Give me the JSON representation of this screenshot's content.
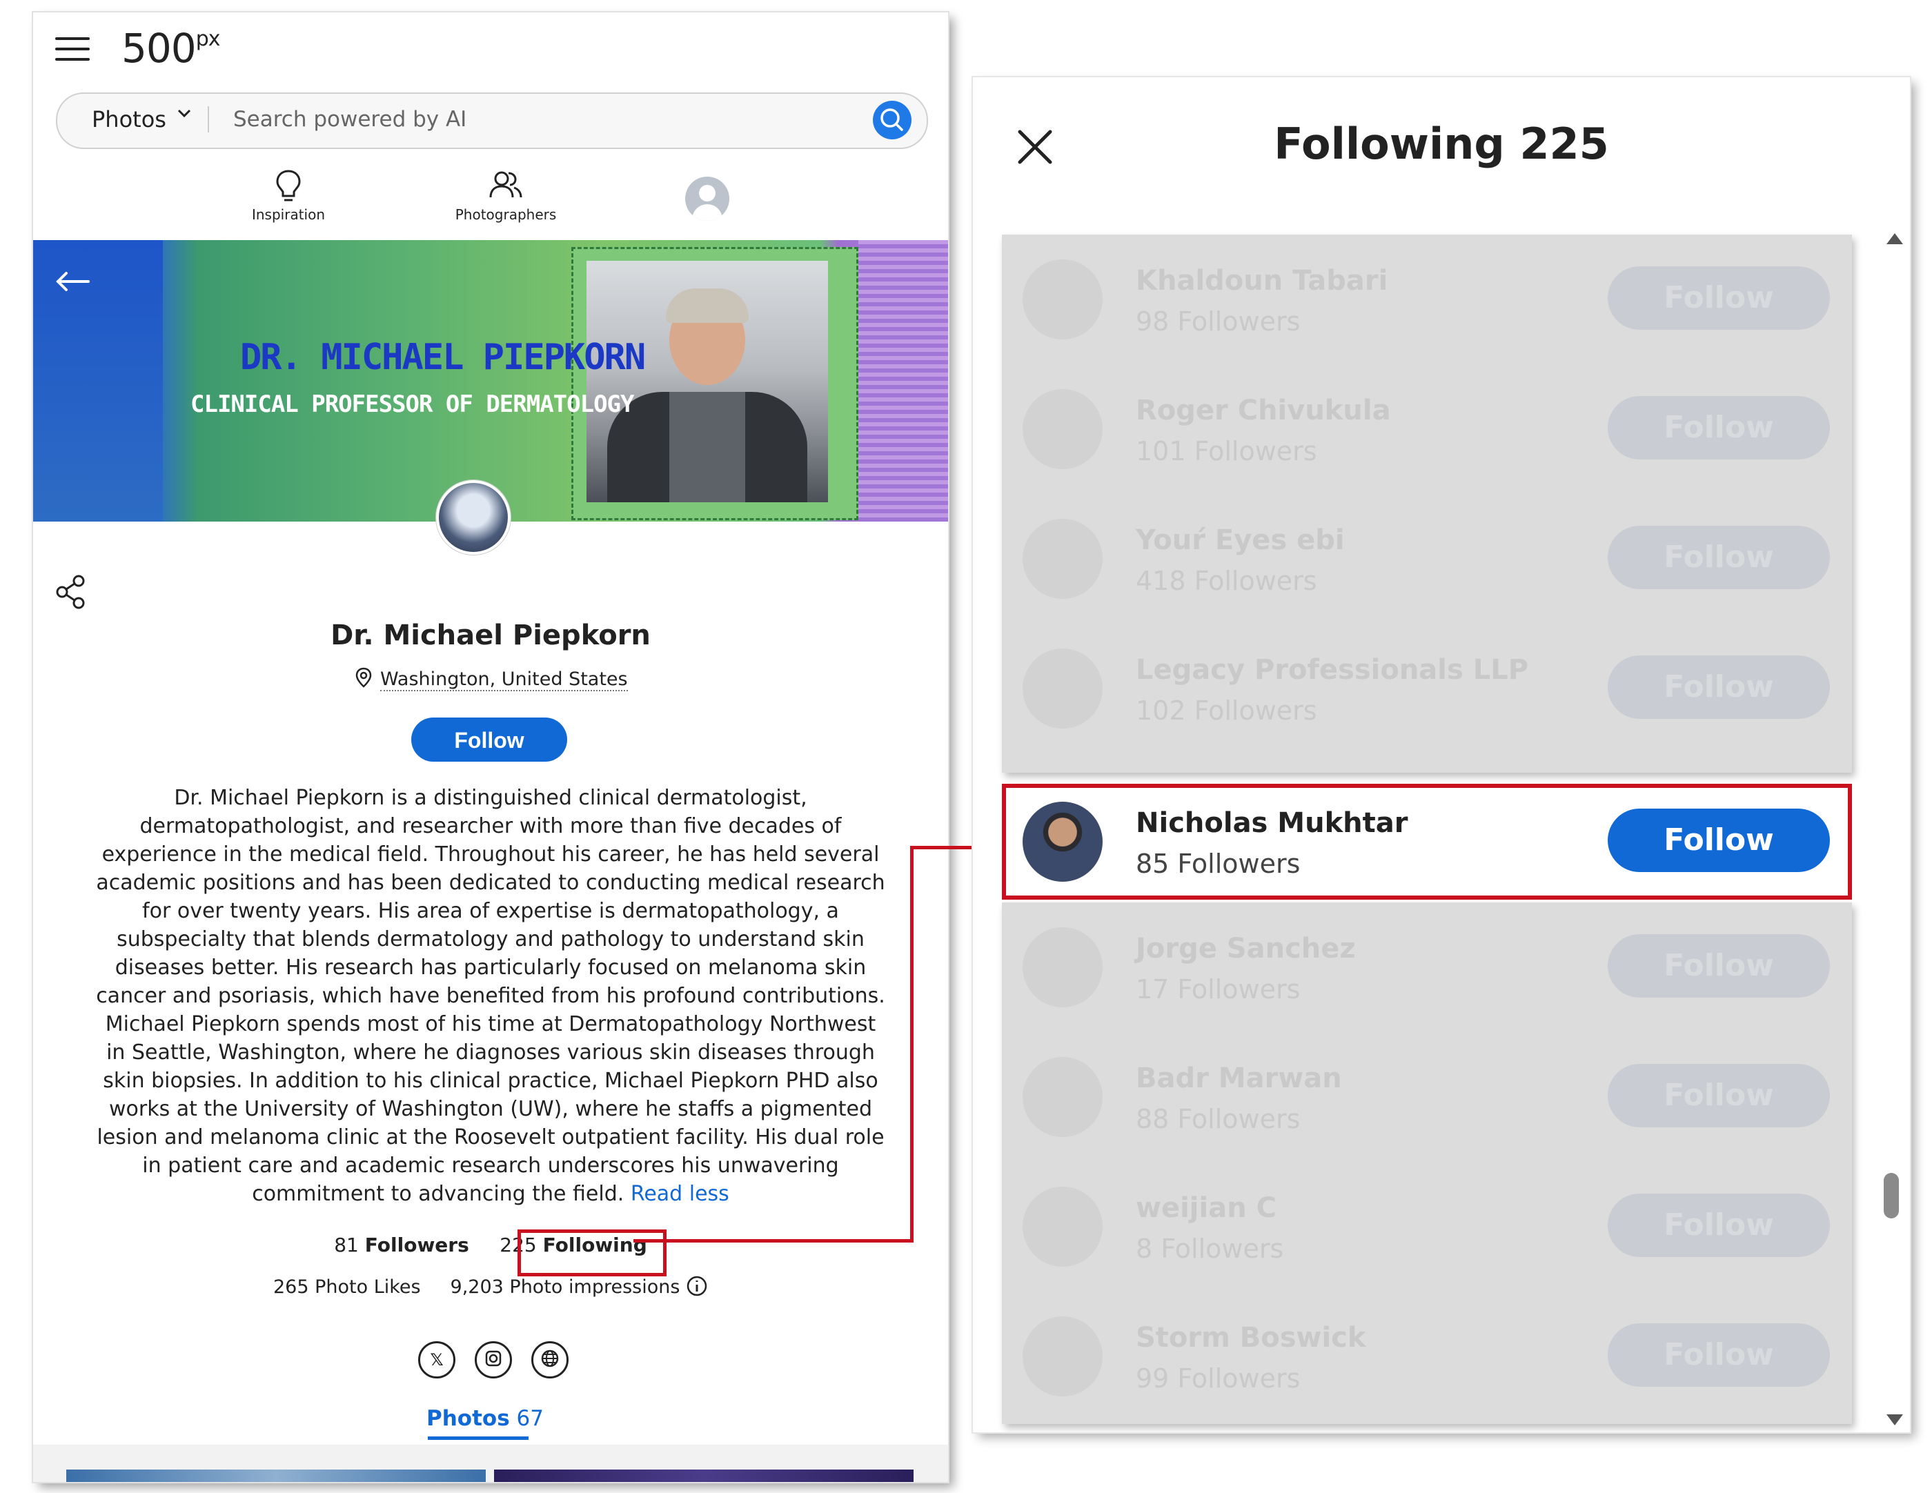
{
  "header": {
    "logo": "500",
    "logo_sup": "px",
    "search_category": "Photos",
    "search_placeholder": "Search powered by AI",
    "nav": [
      {
        "label": "Inspiration"
      },
      {
        "label": "Photographers"
      }
    ]
  },
  "banner": {
    "title": "DR. MICHAEL PIEPKORN",
    "subtitle": "CLINICAL PROFESSOR OF DERMATOLOGY"
  },
  "profile": {
    "name": "Dr. Michael Piepkorn",
    "location": "Washington, United States",
    "follow_label": "Follow",
    "bio": "Dr. Michael Piepkorn is a distinguished clinical dermatologist, dermatopathologist, and researcher with more than five decades of experience in the medical field. Throughout his career, he has held several academic positions and has been dedicated to conducting medical research for over twenty years. His area of expertise is dermatopathology, a subspecialty that blends dermatology and pathology to understand skin diseases better. His research has particularly focused on melanoma skin cancer and psoriasis, which have benefited from his profound contributions. Michael Piepkorn spends most of his time at Dermatopathology Northwest in Seattle, Washington, where he diagnoses various skin diseases through skin biopsies. In addition to his clinical practice, Michael Piepkorn PHD also works at the University of Washington (UW), where he staffs a pigmented lesion and melanoma clinic at the Roosevelt outpatient facility. His dual role in patient care and academic research underscores his unwavering commitment to advancing the field.",
    "read_less": "Read less",
    "followers_count": "81",
    "followers_label": "Followers",
    "following_count": "225",
    "following_label": "Following",
    "photo_likes": "265 Photo Likes",
    "photo_impressions": "9,203 Photo impressions",
    "photos_tab_label": "Photos",
    "photos_tab_count": "67"
  },
  "modal": {
    "title": "Following 225",
    "rows_top": [
      {
        "name": "Khaldoun Tabari",
        "followers": "98 Followers",
        "button": "Follow"
      },
      {
        "name": "Roger Chivukula",
        "followers": "101 Followers",
        "button": "Follow"
      },
      {
        "name": "Youŕ Eyes ebi",
        "followers": "418 Followers",
        "button": "Follow"
      },
      {
        "name": "Legacy Professionals LLP",
        "followers": "102 Followers",
        "button": "Follow"
      }
    ],
    "highlight": {
      "name": "Nicholas Mukhtar",
      "followers": "85 Followers",
      "button": "Follow"
    },
    "rows_bottom": [
      {
        "name": "Jorge Sanchez",
        "followers": "17 Followers",
        "button": "Follow"
      },
      {
        "name": "Badr Marwan",
        "followers": "88 Followers",
        "button": "Follow"
      },
      {
        "name": "weijian C",
        "followers": "8 Followers",
        "button": "Follow"
      },
      {
        "name": "Storm Boswick",
        "followers": "99 Followers",
        "button": "Follow"
      }
    ]
  },
  "colors": {
    "accent": "#1169d6",
    "highlight": "#c8101e"
  }
}
